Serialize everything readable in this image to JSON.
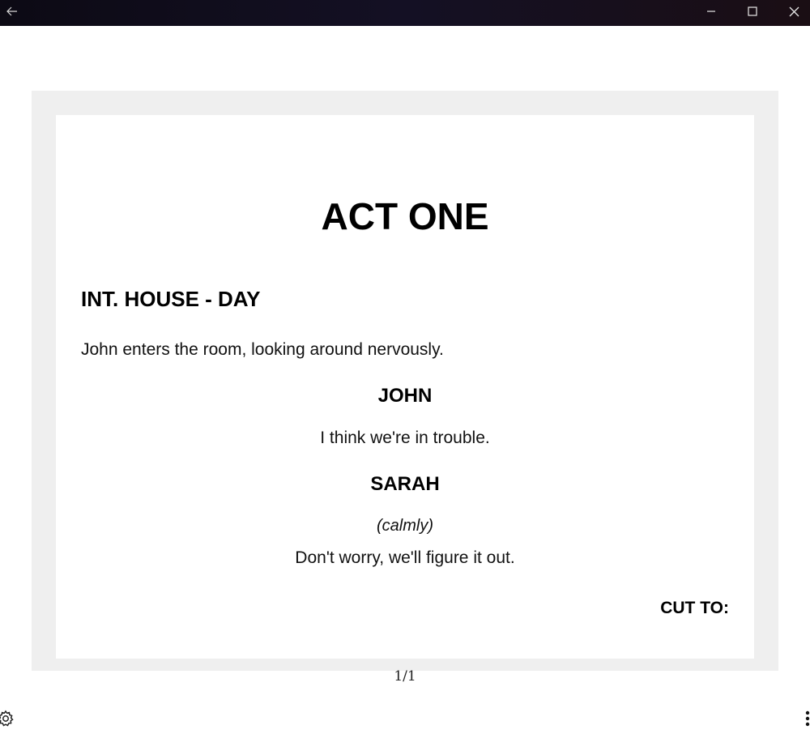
{
  "titlebar": {
    "back_icon": "arrow-left-icon",
    "minimize_icon": "minimize-icon",
    "maximize_icon": "maximize-icon",
    "close_icon": "close-icon"
  },
  "script": {
    "act_heading": "ACT ONE",
    "scene_heading": "INT. HOUSE - DAY",
    "action": "John enters the room, looking around nervously.",
    "character_1": "JOHN",
    "dialogue_1": "I think we're in trouble.",
    "character_2": "SARAH",
    "parenthetical_2": "(calmly)",
    "dialogue_2": "Don't worry, we'll figure it out.",
    "transition": "CUT TO:"
  },
  "footer": {
    "page_indicator": "1/1",
    "settings_icon": "gear-icon",
    "more_icon": "more-vertical-icon"
  }
}
